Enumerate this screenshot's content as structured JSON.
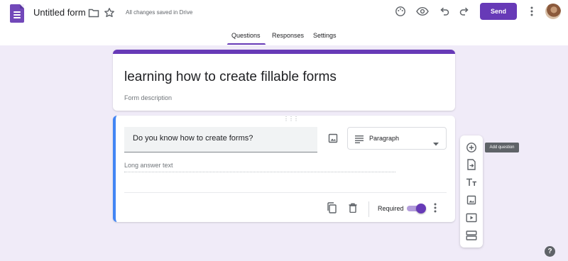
{
  "app": {
    "title": "Untitled form",
    "save_status": "All changes saved in Drive",
    "send_label": "Send",
    "icons": [
      "forms-logo-icon",
      "folder-icon",
      "star-icon",
      "palette-icon",
      "eye-icon",
      "undo-icon",
      "redo-icon",
      "more-vert-icon",
      "avatar"
    ]
  },
  "tabs": [
    {
      "label": "Questions",
      "active": true
    },
    {
      "label": "Responses",
      "active": false
    },
    {
      "label": "Settings",
      "active": false
    }
  ],
  "form": {
    "heading": "learning how to create fillable forms",
    "description_placeholder": "Form description"
  },
  "question": {
    "text": "Do you know how to create forms?",
    "type": "Paragraph",
    "answer_placeholder": "Long answer text",
    "required_label": "Required",
    "required": true
  },
  "toolbar": {
    "tooltip": "Add question",
    "items": [
      "add-question-icon",
      "import-questions-icon",
      "add-title-icon",
      "add-image-icon",
      "add-video-icon",
      "add-section-icon"
    ]
  },
  "help_label": "?",
  "colors": {
    "accent": "#673ab7",
    "background": "#f0ebf8",
    "active_card_border": "#4285f4"
  }
}
